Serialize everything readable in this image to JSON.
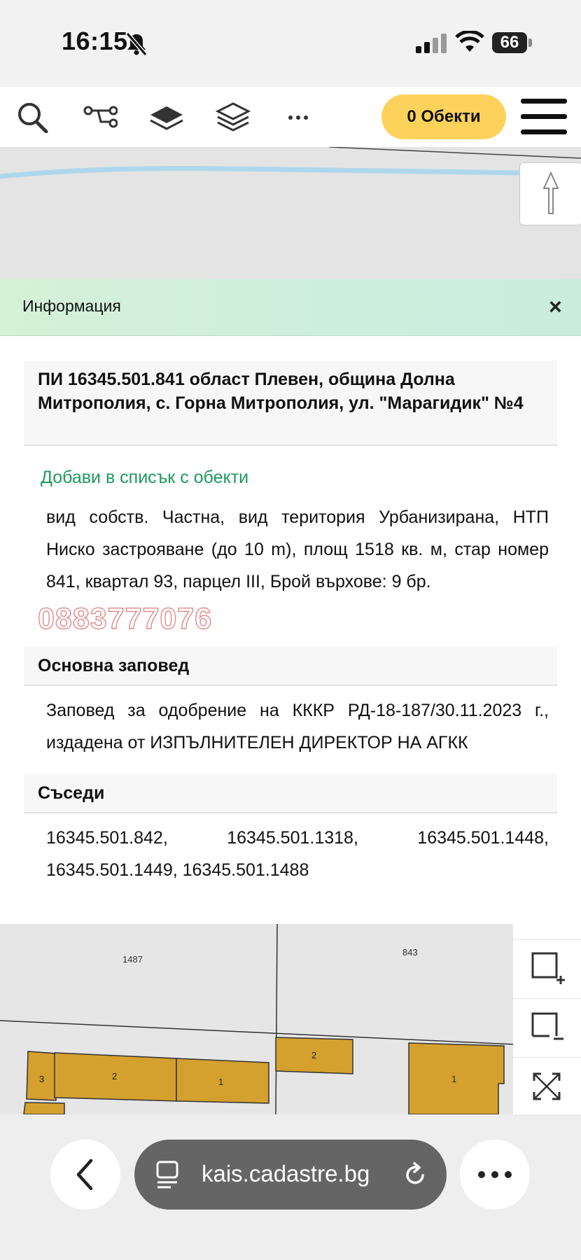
{
  "status_bar": {
    "time": "16:15",
    "battery": "66"
  },
  "toolbar": {
    "objects_label": "0 Обекти"
  },
  "info_panel": {
    "title": "Информация",
    "close": "×",
    "address": "ПИ 16345.501.841 област Плевен, община Долна Митрополия, с. Горна Митрополия, ул. \"Марагидик\" №4",
    "add_link": "Добави в списък с обекти",
    "details": "вид собств. Частна, вид територия Урбанизирана, НТП Ниско застрояване (до 10 m), площ 1518 кв. м, стар номер 841, квартал 93, парцел III, Брой върхове: 9 бр.",
    "watermark": "0883777076",
    "order_heading": "Основна заповед",
    "order_text": "Заповед за одобрение на КККР РД-18-187/30.11.2023 г., издадена от ИЗПЪЛНИТЕЛЕН ДИРЕКТОР НА АГКК",
    "neighbors_heading": "Съседи",
    "neighbors_text": "16345.501.842, 16345.501.1318, 16345.501.1448, 16345.501.1449, 16345.501.1488"
  },
  "map": {
    "parcel_labels": [
      "1487",
      "843"
    ],
    "building_labels": [
      "3",
      "2",
      "1",
      "2",
      "1"
    ]
  },
  "browser": {
    "url": "kais.cadastre.bg"
  },
  "colors": {
    "accent": "#fdd25b",
    "building": "#d4a02e",
    "link": "#1d9a5e"
  }
}
